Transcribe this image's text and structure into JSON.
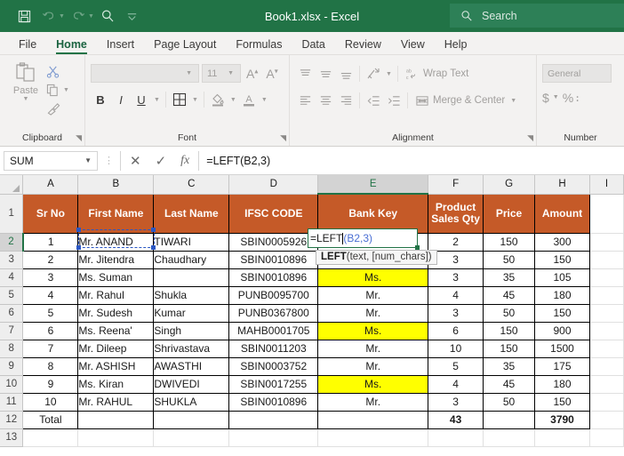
{
  "titlebar": {
    "title": "Book1.xlsx  -  Excel",
    "qat": [
      {
        "name": "save-icon",
        "glyph": "ὋE"
      },
      {
        "name": "undo-icon",
        "glyph": "↶"
      },
      {
        "name": "redo-icon",
        "glyph": "↷"
      },
      {
        "name": "search-icon",
        "glyph": "⚲"
      },
      {
        "name": "customize-qat-icon",
        "glyph": "⌄"
      }
    ],
    "search_placeholder": "Search",
    "brand_color": "#217346"
  },
  "tabs": [
    {
      "label": "File",
      "active": false
    },
    {
      "label": "Home",
      "active": true
    },
    {
      "label": "Insert",
      "active": false
    },
    {
      "label": "Page Layout",
      "active": false
    },
    {
      "label": "Formulas",
      "active": false
    },
    {
      "label": "Data",
      "active": false
    },
    {
      "label": "Review",
      "active": false
    },
    {
      "label": "View",
      "active": false
    },
    {
      "label": "Help",
      "active": false
    }
  ],
  "ribbon": {
    "clipboard": {
      "label": "Clipboard",
      "paste_label": "Paste",
      "cut_label": "Cut",
      "copy_label": "Copy",
      "format_painter_label": "Format Painter"
    },
    "font": {
      "label": "Font",
      "font_name_value": "",
      "font_size_value": "11",
      "grow_label": "A",
      "shrink_label": "A",
      "bold_label": "B",
      "italic_label": "I",
      "underline_label": "U",
      "borders_label": "Borders",
      "fill_color_label": "A",
      "font_color_label": "A"
    },
    "alignment": {
      "label": "Alignment",
      "wrap_text_label": "Wrap Text",
      "merge_center_label": "Merge & Center"
    },
    "number": {
      "label": "Number",
      "format_value": "General",
      "currency_label": "$",
      "percent_label": "%",
      "comma_label": "։"
    }
  },
  "formula_bar": {
    "name_box_value": "SUM",
    "cancel_label": "✕",
    "enter_label": "✓",
    "fx_label": "fx",
    "formula_value": "=LEFT(B2,3)"
  },
  "grid": {
    "columns": [
      "A",
      "B",
      "C",
      "D",
      "E",
      "F",
      "G",
      "H",
      "I"
    ],
    "selected_column": "E",
    "selected_row": "2",
    "rows": [
      "1",
      "2",
      "3",
      "4",
      "5",
      "6",
      "7",
      "8",
      "9",
      "10",
      "11",
      "12",
      "13"
    ],
    "headers": {
      "A": "Sr No",
      "B": "First Name",
      "C": "Last Name",
      "D": "IFSC CODE",
      "E": "Bank Key",
      "F": "Product Sales Qty",
      "G": "Price",
      "H": "Amount"
    },
    "data": [
      {
        "sr": "1",
        "first": "Mr. ANAND",
        "last": "TIWARI",
        "ifsc": "SBIN0005926",
        "bank": "",
        "qty": "2",
        "price": "150",
        "amount": "300",
        "yellow": false
      },
      {
        "sr": "2",
        "first": "Mr. Jitendra",
        "last": "Chaudhary",
        "ifsc": "SBIN0010896",
        "bank": "",
        "qty": "3",
        "price": "50",
        "amount": "150",
        "yellow": false
      },
      {
        "sr": "3",
        "first": "Ms. Suman",
        "last": "",
        "ifsc": "SBIN0010896",
        "bank": "Ms.",
        "qty": "3",
        "price": "35",
        "amount": "105",
        "yellow": true
      },
      {
        "sr": "4",
        "first": "Mr. Rahul",
        "last": "Shukla",
        "ifsc": "PUNB0095700",
        "bank": "Mr.",
        "qty": "4",
        "price": "45",
        "amount": "180",
        "yellow": false
      },
      {
        "sr": "5",
        "first": "Mr. Sudesh",
        "last": "Kumar",
        "ifsc": "PUNB0367800",
        "bank": "Mr.",
        "qty": "3",
        "price": "50",
        "amount": "150",
        "yellow": false
      },
      {
        "sr": "6",
        "first": "Ms. Reena'",
        "last": "Singh",
        "ifsc": "MAHB0001705",
        "bank": "Ms.",
        "qty": "6",
        "price": "150",
        "amount": "900",
        "yellow": true
      },
      {
        "sr": "7",
        "first": "Mr. Dileep",
        "last": "Shrivastava",
        "ifsc": "SBIN0011203",
        "bank": "Mr.",
        "qty": "10",
        "price": "150",
        "amount": "1500",
        "yellow": false
      },
      {
        "sr": "8",
        "first": "Mr. ASHISH",
        "last": "AWASTHI",
        "ifsc": "SBIN0003752",
        "bank": "Mr.",
        "qty": "5",
        "price": "35",
        "amount": "175",
        "yellow": false
      },
      {
        "sr": "9",
        "first": "Ms. Kiran",
        "last": "DWIVEDI",
        "ifsc": "SBIN0017255",
        "bank": "Ms.",
        "qty": "4",
        "price": "45",
        "amount": "180",
        "yellow": true
      },
      {
        "sr": "10",
        "first": "Mr. RAHUL",
        "last": "SHUKLA",
        "ifsc": "SBIN0010896",
        "bank": "Mr.",
        "qty": "3",
        "price": "50",
        "amount": "150",
        "yellow": false
      }
    ],
    "total_row": {
      "label": "Total",
      "qty": "43",
      "price": "",
      "amount": "3790"
    },
    "active_cell": {
      "address": "E2",
      "editing_text_fn": "=LEFT",
      "editing_text_ref": "(B2,3)"
    },
    "tooltip": {
      "fn": "LEFT",
      "args": "(text, [num_chars])"
    },
    "header_fill": "#c55a28",
    "highlight_fill": "#ffff00"
  }
}
